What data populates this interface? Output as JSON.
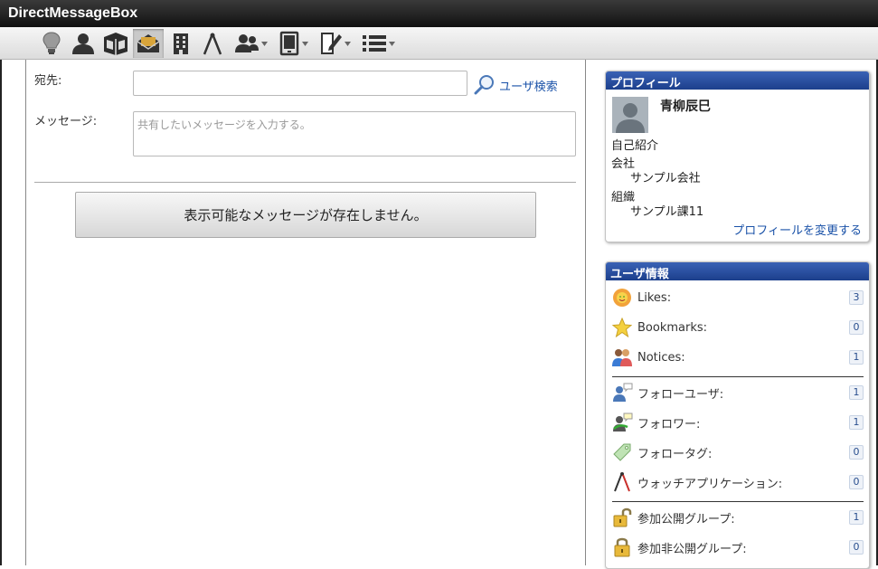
{
  "window": {
    "title": "DirectMessageBox"
  },
  "toolbar": {
    "icons": [
      "lightbulb-icon",
      "user-icon",
      "box-icon",
      "mail-icon",
      "building-icon",
      "compass-icon",
      "group-icon",
      "tablet-icon",
      "edit-icon",
      "list-icon"
    ]
  },
  "form": {
    "to_label": "宛先:",
    "to_value": "",
    "search_label": "ユーザ検索",
    "message_label": "メッセージ:",
    "message_placeholder": "共有したいメッセージを入力する。"
  },
  "messages": {
    "empty_text": "表示可能なメッセージが存在しません。"
  },
  "profile": {
    "header": "プロフィール",
    "name": "青柳辰巳",
    "bio_label": "自己紹介",
    "company_label": "会社",
    "company_value": "サンプル会社",
    "org_label": "組織",
    "org_value": "サンプル課11",
    "edit_link": "プロフィールを変更する"
  },
  "user_info": {
    "header": "ユーザ情報",
    "stats": [
      {
        "label": "Likes:",
        "count": "3",
        "icon": "likes-icon"
      },
      {
        "label": "Bookmarks:",
        "count": "0",
        "icon": "star-icon"
      },
      {
        "label": "Notices:",
        "count": "1",
        "icon": "notices-icon"
      },
      {
        "label": "フォローユーザ:",
        "count": "1",
        "icon": "follow-user-icon"
      },
      {
        "label": "フォロワー:",
        "count": "1",
        "icon": "follower-icon"
      },
      {
        "label": "フォロータグ:",
        "count": "0",
        "icon": "tag-icon"
      },
      {
        "label": "ウォッチアプリケーション:",
        "count": "0",
        "icon": "watch-app-icon"
      },
      {
        "label": "参加公開グループ:",
        "count": "1",
        "icon": "unlock-icon"
      },
      {
        "label": "参加非公開グループ:",
        "count": "0",
        "icon": "lock-icon"
      }
    ]
  },
  "colors": {
    "header_blue": "#1c3f8c",
    "link_blue": "#1a52a8",
    "titlebar": "#1a1a1a"
  }
}
